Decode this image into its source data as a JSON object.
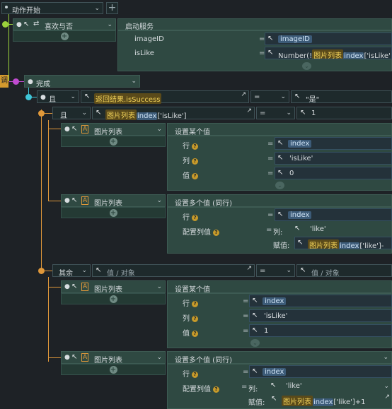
{
  "top": {
    "event": "动作开始",
    "plus": "+"
  },
  "row1": {
    "action": "喜欢与否",
    "service": "启动服务"
  },
  "params": {
    "imageID_label": "imageID",
    "imageID_value": "imageID",
    "isLike_label": "isLike",
    "isLike_prefix": "Number(!",
    "isLike_list": "图片列表",
    "isLike_index": "index",
    "isLike_tail": "['isLike'"
  },
  "callback": {
    "tag": "调",
    "label": "完成"
  },
  "cond1": {
    "op": "且",
    "left": "返回结果.isSuccess",
    "eq": "=",
    "right": "\"是\""
  },
  "cond2": {
    "op": "且",
    "list": "图片列表",
    "index": "index",
    "tail": "['isLike']",
    "eq": "=",
    "right": "1"
  },
  "block1": {
    "target": "图片列表",
    "action": "设置某个值",
    "row_label": "行",
    "row_value": "index",
    "col_label": "列",
    "col_value": "'isLike'",
    "val_label": "值",
    "val_value": "0"
  },
  "block2": {
    "target": "图片列表",
    "action": "设置多个值 (同行)",
    "row_label": "行",
    "row_value": "index",
    "cfg_label": "配置列值",
    "col_key": "列:",
    "col_value": "'like'",
    "assign_key": "赋值:",
    "assign_list": "图片列表",
    "assign_index": "index",
    "assign_tail": "['like']-"
  },
  "else": {
    "op": "其余",
    "left": "值 / 对象",
    "eq": "=",
    "right": "值 / 对象"
  },
  "block3": {
    "target": "图片列表",
    "action": "设置某个值",
    "row_label": "行",
    "row_value": "index",
    "col_label": "列",
    "col_value": "'isLike'",
    "val_label": "值",
    "val_value": "1"
  },
  "block4": {
    "target": "图片列表",
    "action": "设置多个值 (同行)",
    "row_label": "行",
    "row_value": "index",
    "cfg_label": "配置列值",
    "col_key": "列:",
    "col_value": "'like'",
    "assign_key": "赋值:",
    "assign_list": "图片列表",
    "assign_index": "index",
    "assign_tail": "['like']+1"
  },
  "colors": {
    "bg": "#1e2226",
    "block": "#2f4942",
    "connector": "#e0983a",
    "green_dot": "#9bd13b",
    "magenta_dot": "#c04bd0",
    "cyan_dot": "#3fc6d8"
  }
}
